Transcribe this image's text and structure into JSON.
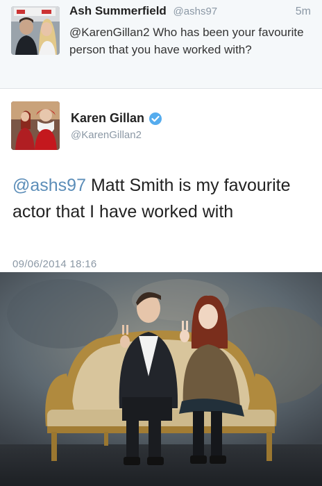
{
  "reply": {
    "name": "Ash Summerfield",
    "handle": "@ashs97",
    "time": "5m",
    "text": "@KarenGillan2 Who has been your favourite person that you have worked with?"
  },
  "tweet": {
    "name": "Karen Gillan",
    "handle": "@KarenGillan2",
    "mention": "@ashs97",
    "text": " Matt Smith is my favourite actor that I have worked with",
    "timestamp": "09/06/2014 18:16"
  },
  "colors": {
    "link": "#5b8db8",
    "verified": "#55acee",
    "meta": "#8b98a5"
  },
  "icons": {
    "verified": "verified-badge-icon"
  }
}
